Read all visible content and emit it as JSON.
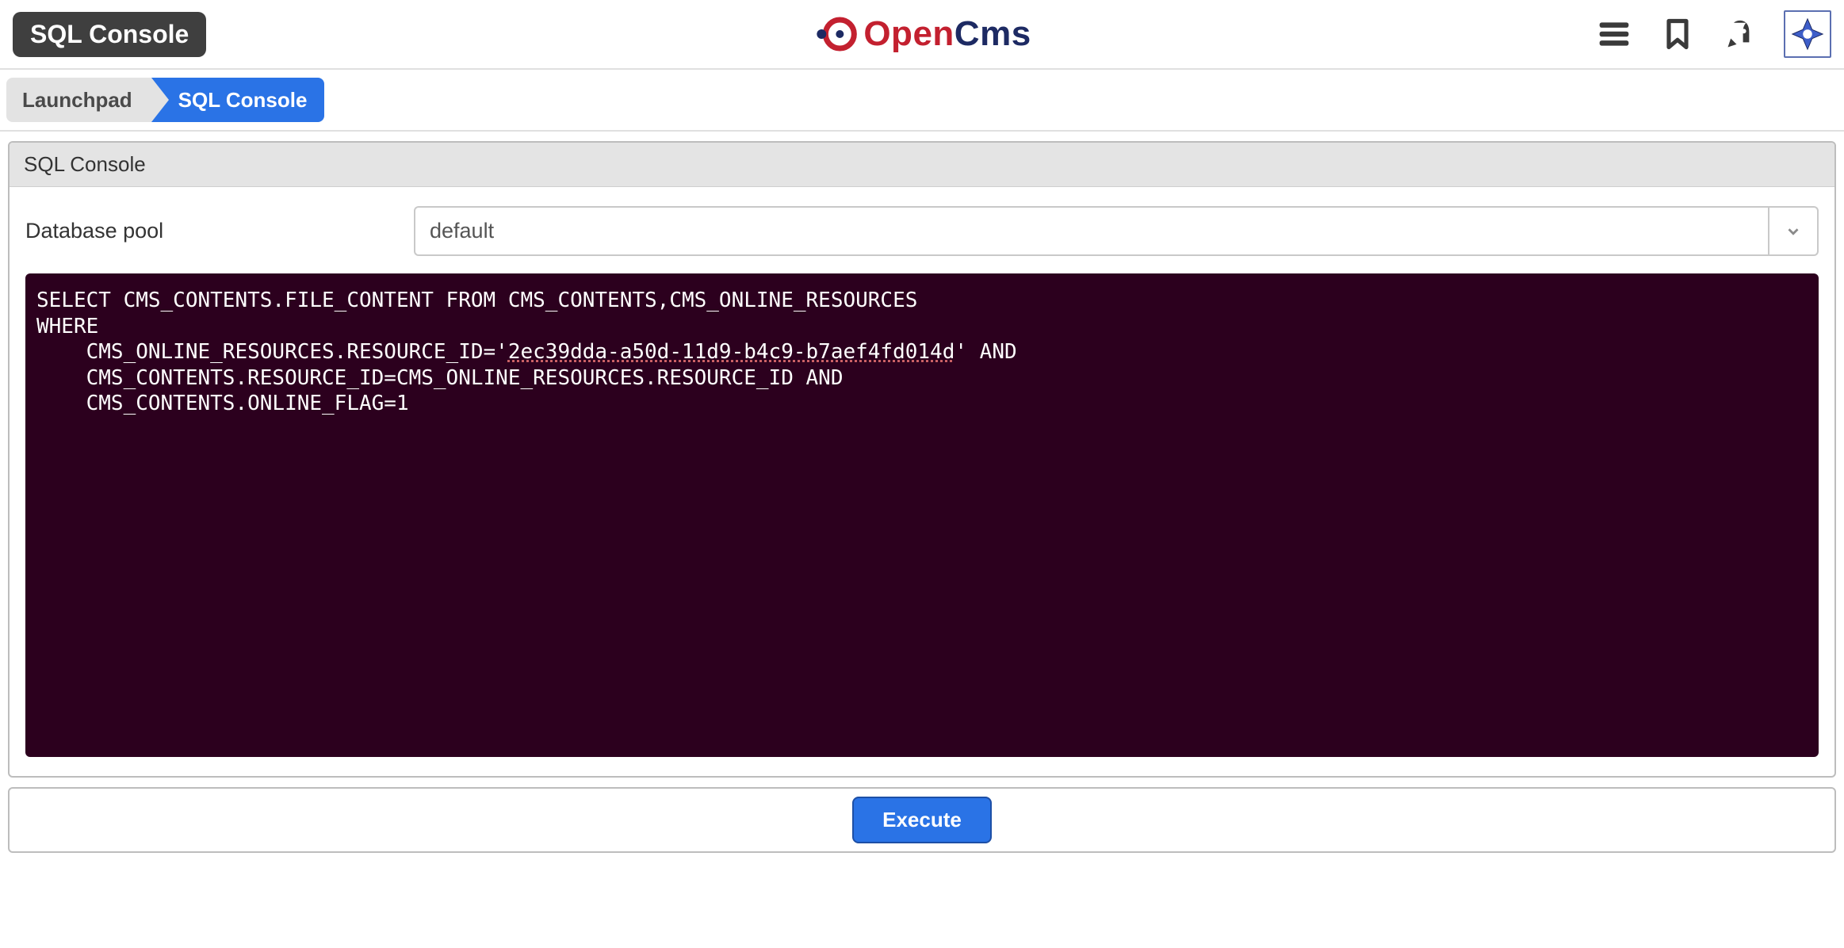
{
  "header": {
    "title": "SQL Console"
  },
  "breadcrumbs": [
    {
      "label": "Launchpad"
    },
    {
      "label": "SQL Console"
    }
  ],
  "panel": {
    "title": "SQL Console",
    "db_pool_label": "Database pool",
    "db_pool_value": "default",
    "sql": "SELECT CMS_CONTENTS.FILE_CONTENT FROM CMS_CONTENTS,CMS_ONLINE_RESOURCES\nWHERE\n    CMS_ONLINE_RESOURCES.RESOURCE_ID='2ec39dda-a50d-11d9-b4c9-b7aef4fd014d' AND\n    CMS_CONTENTS.RESOURCE_ID=CMS_ONLINE_RESOURCES.RESOURCE_ID AND\n    CMS_CONTENTS.ONLINE_FLAG=1"
  },
  "actions": {
    "execute": "Execute"
  },
  "logo": {
    "open": "Open",
    "cms": "Cms"
  }
}
